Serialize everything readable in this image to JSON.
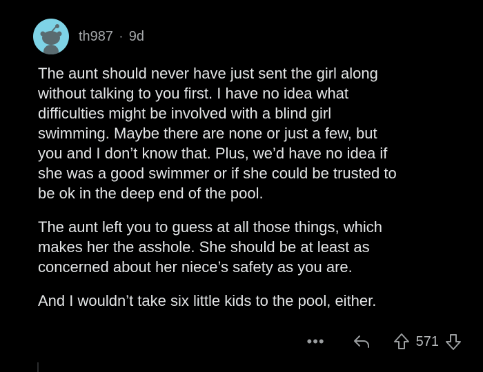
{
  "comment": {
    "username": "th987",
    "separator": "·",
    "age": "9d",
    "paragraphs": [
      "The aunt should never have just sent the girl along\nwithout talking to you first. I have no idea what\ndifficulties might be involved with a blind girl\nswimming. Maybe there are none or just a few, but\nyou and I don’t know that. Plus, we’d have no idea if\nshe was a good swimmer or if she could be trusted to\nbe ok in the deep end of the pool.",
      "The aunt left you to guess at all those things, which\nmakes her the asshole. She should be at least as\nconcerned about her niece’s safety as you are.",
      "And I wouldn’t take six little kids to the pool, either."
    ]
  },
  "actions": {
    "more": "•••",
    "score": "571"
  },
  "icons": {
    "avatar": "reddit-snoo-avatar-icon",
    "more": "more-options-icon",
    "reply": "reply-icon",
    "upvote": "upvote-arrow-icon",
    "downvote": "downvote-arrow-icon"
  },
  "colors": {
    "background": "#000000",
    "text": "#e3e5e6",
    "meta": "#a6a9ab",
    "avatar_bg": "#7ed3e6"
  }
}
